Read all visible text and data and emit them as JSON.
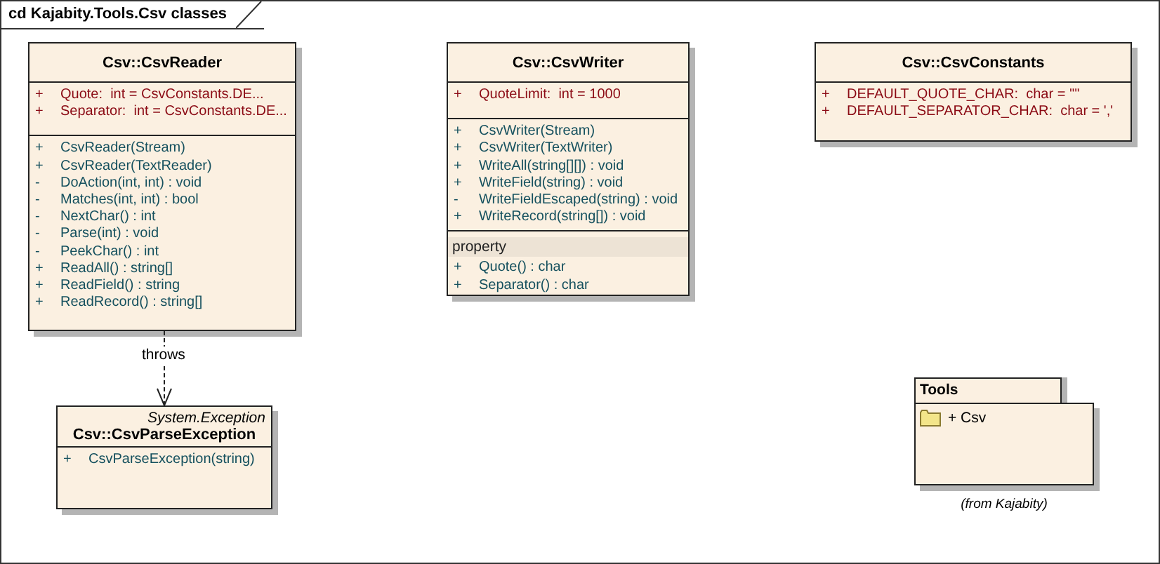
{
  "frame": {
    "title": "cd Kajabity.Tools.Csv classes"
  },
  "classes": [
    {
      "name": "Csv::CsvReader",
      "sections": [
        {
          "kind": "attributes",
          "members": [
            {
              "visibility": "+",
              "signature": "Quote:  int = CsvConstants.DE..."
            },
            {
              "visibility": "+",
              "signature": "Separator:  int = CsvConstants.DE..."
            }
          ]
        },
        {
          "kind": "operations",
          "members": [
            {
              "visibility": "+",
              "signature": "CsvReader(Stream)"
            },
            {
              "visibility": "+",
              "signature": "CsvReader(TextReader)"
            },
            {
              "visibility": "-",
              "signature": "DoAction(int, int) : void"
            },
            {
              "visibility": "-",
              "signature": "Matches(int, int) : bool"
            },
            {
              "visibility": "-",
              "signature": "NextChar() : int"
            },
            {
              "visibility": "-",
              "signature": "Parse(int) : void"
            },
            {
              "visibility": "-",
              "signature": "PeekChar() : int"
            },
            {
              "visibility": "+",
              "signature": "ReadAll() : string[]"
            },
            {
              "visibility": "+",
              "signature": "ReadField() : string"
            },
            {
              "visibility": "+",
              "signature": "ReadRecord() : string[]"
            }
          ]
        }
      ]
    },
    {
      "name": "Csv::CsvWriter",
      "sections": [
        {
          "kind": "attributes",
          "members": [
            {
              "visibility": "+",
              "signature": "QuoteLimit:  int = 1000"
            }
          ]
        },
        {
          "kind": "operations",
          "members": [
            {
              "visibility": "+",
              "signature": "CsvWriter(Stream)"
            },
            {
              "visibility": "+",
              "signature": "CsvWriter(TextWriter)"
            },
            {
              "visibility": "+",
              "signature": "WriteAll(string[][]) : void"
            },
            {
              "visibility": "+",
              "signature": "WriteField(string) : void"
            },
            {
              "visibility": "-",
              "signature": "WriteFieldEscaped(string) : void"
            },
            {
              "visibility": "+",
              "signature": "WriteRecord(string[]) : void"
            }
          ]
        },
        {
          "kind": "operations",
          "label": "property",
          "members": [
            {
              "visibility": "+",
              "signature": "Quote() : char"
            },
            {
              "visibility": "+",
              "signature": "Separator() : char"
            }
          ]
        }
      ]
    },
    {
      "name": "Csv::CsvConstants",
      "sections": [
        {
          "kind": "attributes",
          "members": [
            {
              "visibility": "+",
              "signature": "DEFAULT_QUOTE_CHAR:  char = '\"'"
            },
            {
              "visibility": "+",
              "signature": "DEFAULT_SEPARATOR_CHAR:  char = ','"
            }
          ]
        }
      ]
    },
    {
      "name": "Csv::CsvParseException",
      "stereotype": "System.Exception",
      "sections": [
        {
          "kind": "operations",
          "members": [
            {
              "visibility": "+",
              "signature": "CsvParseException(string)"
            }
          ]
        }
      ]
    }
  ],
  "dependency": {
    "label": "throws"
  },
  "package": {
    "name": "Tools",
    "contents": [
      "+ Csv"
    ],
    "note": "(from Kajabity)"
  }
}
